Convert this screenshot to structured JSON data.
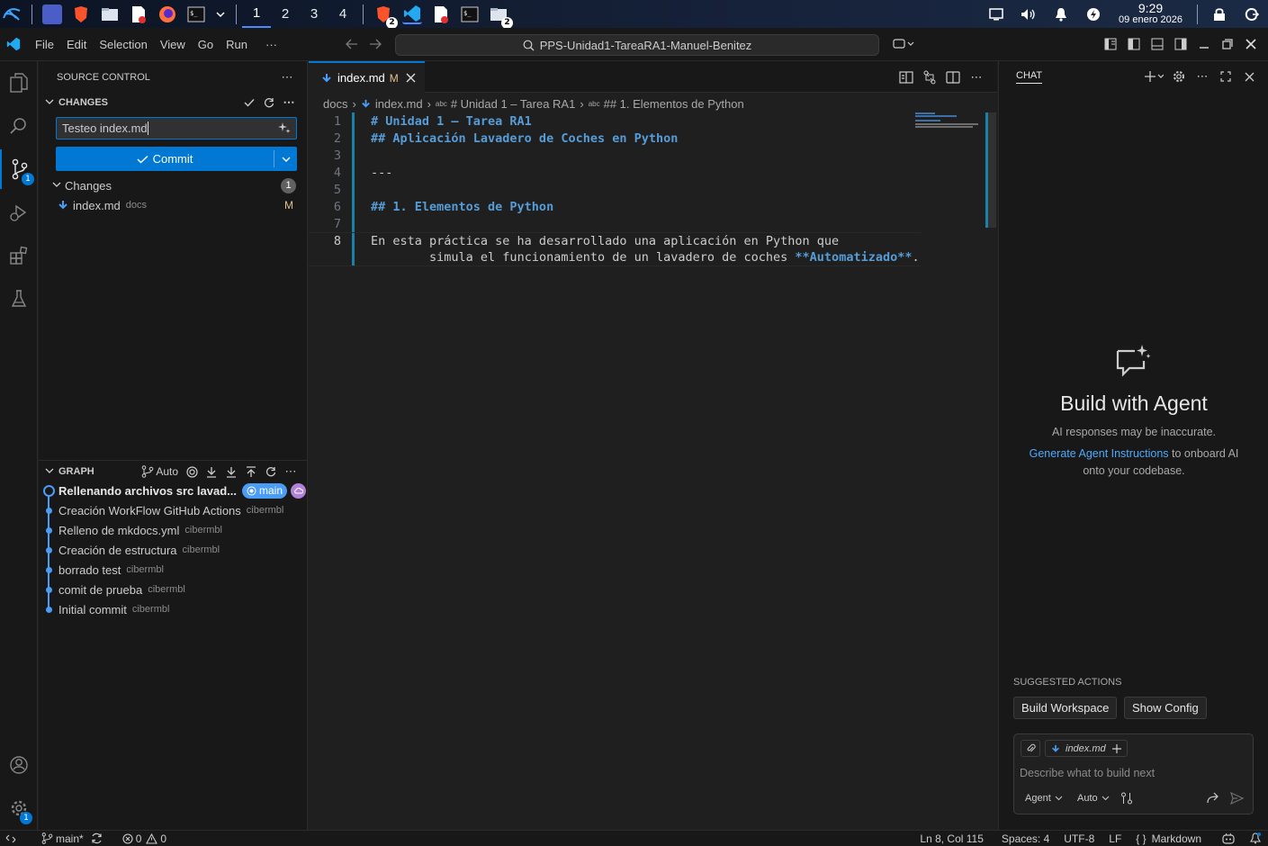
{
  "taskbar": {
    "workspaces": [
      "1",
      "2",
      "3",
      "4"
    ],
    "active_workspace": "1",
    "clock_time": "9:29",
    "clock_date": "09 enero 2026",
    "brave_badge": "2",
    "files_badge": "2"
  },
  "titlebar": {
    "menu": [
      "File",
      "Edit",
      "Selection",
      "View",
      "Go",
      "Run",
      "···"
    ],
    "command_center": "PPS-Unidad1-TareaRA1-Manuel-Benitez"
  },
  "activity": {
    "scm_badge": "1",
    "settings_badge": "1"
  },
  "sidebar": {
    "title": "SOURCE CONTROL",
    "changes_header": "CHANGES",
    "commit_message": "Testeo  index.md",
    "commit_label": "Commit",
    "changes_group": "Changes",
    "changes_count": "1",
    "files": [
      {
        "name": "index.md",
        "folder": "docs",
        "status": "M"
      }
    ],
    "graph_header": "GRAPH",
    "graph_auto": "Auto",
    "graph": [
      {
        "message": "Rellenando archivos src lavad...",
        "author": "",
        "branch": "main"
      },
      {
        "message": "Creación WorkFlow GitHub Actions",
        "author": "cibermbl"
      },
      {
        "message": "Relleno de mkdocs.yml",
        "author": "cibermbl"
      },
      {
        "message": "Creación de estructura",
        "author": "cibermbl"
      },
      {
        "message": "borrado test",
        "author": "cibermbl"
      },
      {
        "message": "comit de prueba",
        "author": "cibermbl"
      },
      {
        "message": "Initial commit",
        "author": "cibermbl"
      }
    ]
  },
  "editor": {
    "tab_label": "index.md",
    "tab_status": "M",
    "breadcrumb": [
      "docs",
      "index.md",
      "# Unidad 1 – Tarea RA1",
      "## 1. Elementos de Python"
    ],
    "lines": [
      {
        "n": "1",
        "text": "# Unidad 1 – Tarea RA1",
        "kind": "heading"
      },
      {
        "n": "2",
        "text": "## Aplicación Lavadero de Coches en Python",
        "kind": "heading"
      },
      {
        "n": "3",
        "text": "",
        "kind": "text"
      },
      {
        "n": "4",
        "text": "---",
        "kind": "text"
      },
      {
        "n": "5",
        "text": "",
        "kind": "text"
      },
      {
        "n": "6",
        "text": "## 1. Elementos de Python",
        "kind": "heading"
      },
      {
        "n": "7",
        "text": "",
        "kind": "text"
      },
      {
        "n": "8",
        "text": "En esta práctica se ha desarrollado una aplicación en Python que",
        "kind": "text"
      }
    ],
    "wrap_line_prefix": "simula el funcionamiento de un lavadero de coches ",
    "wrap_line_bold": "**Automatizado**",
    "wrap_line_suffix": "."
  },
  "chat": {
    "title": "CHAT",
    "heading": "Build with Agent",
    "disclaimer": "AI responses may be inaccurate.",
    "link": "Generate Agent Instructions",
    "link_suffix": " to onboard AI onto your codebase.",
    "suggested_header": "SUGGESTED ACTIONS",
    "suggested": [
      "Build Workspace",
      "Show Config"
    ],
    "context_file": "index.md",
    "placeholder": "Describe what to build next",
    "mode": "Agent",
    "model": "Auto"
  },
  "statusbar": {
    "branch": "main*",
    "errors": "0",
    "warnings": "0",
    "position": "Ln 8, Col 115",
    "spaces": "Spaces: 4",
    "encoding": "UTF-8",
    "eol": "LF",
    "language": "Markdown",
    "lang_braces": "{ }"
  },
  "colors": {
    "accent": "#0078d4",
    "heading": "#569cd6",
    "graph_dot": "#4a9cf5"
  }
}
